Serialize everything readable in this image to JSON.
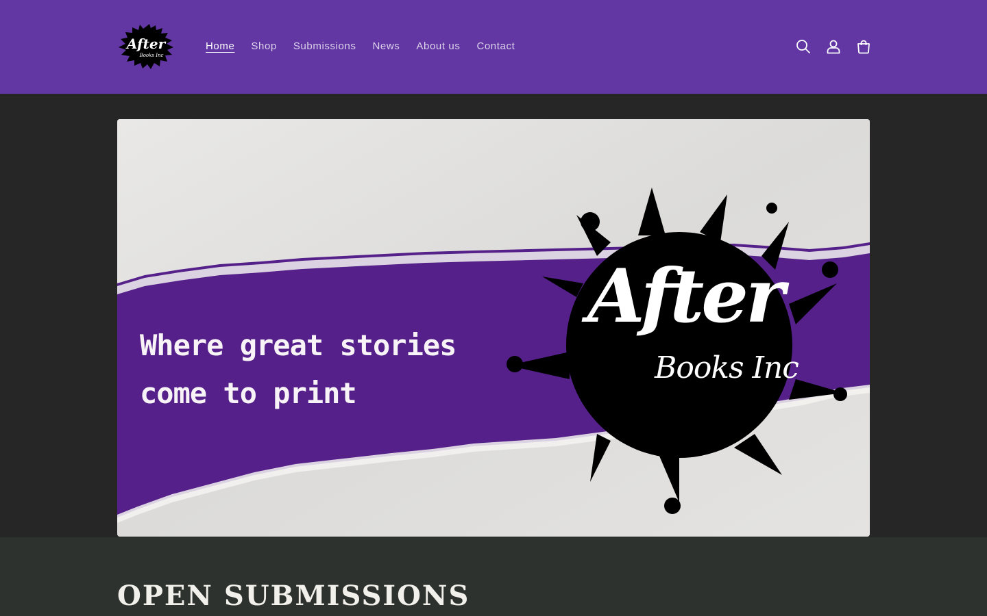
{
  "header": {
    "logo": {
      "title": "After",
      "subtitle": "Books Inc"
    },
    "nav": [
      {
        "label": "Home",
        "active": true
      },
      {
        "label": "Shop"
      },
      {
        "label": "Submissions"
      },
      {
        "label": "News"
      },
      {
        "label": "About us"
      },
      {
        "label": "Contact"
      }
    ],
    "icons": [
      "search-icon",
      "account-icon",
      "cart-icon"
    ],
    "background_color": "#6236a3"
  },
  "hero": {
    "tagline_line1": "Where great stories",
    "tagline_line2": "come to print",
    "brand_title": "After",
    "brand_subtitle": "Books Inc",
    "band_color": "#55208a"
  },
  "section": {
    "title": "OPEN SUBMISSIONS"
  }
}
